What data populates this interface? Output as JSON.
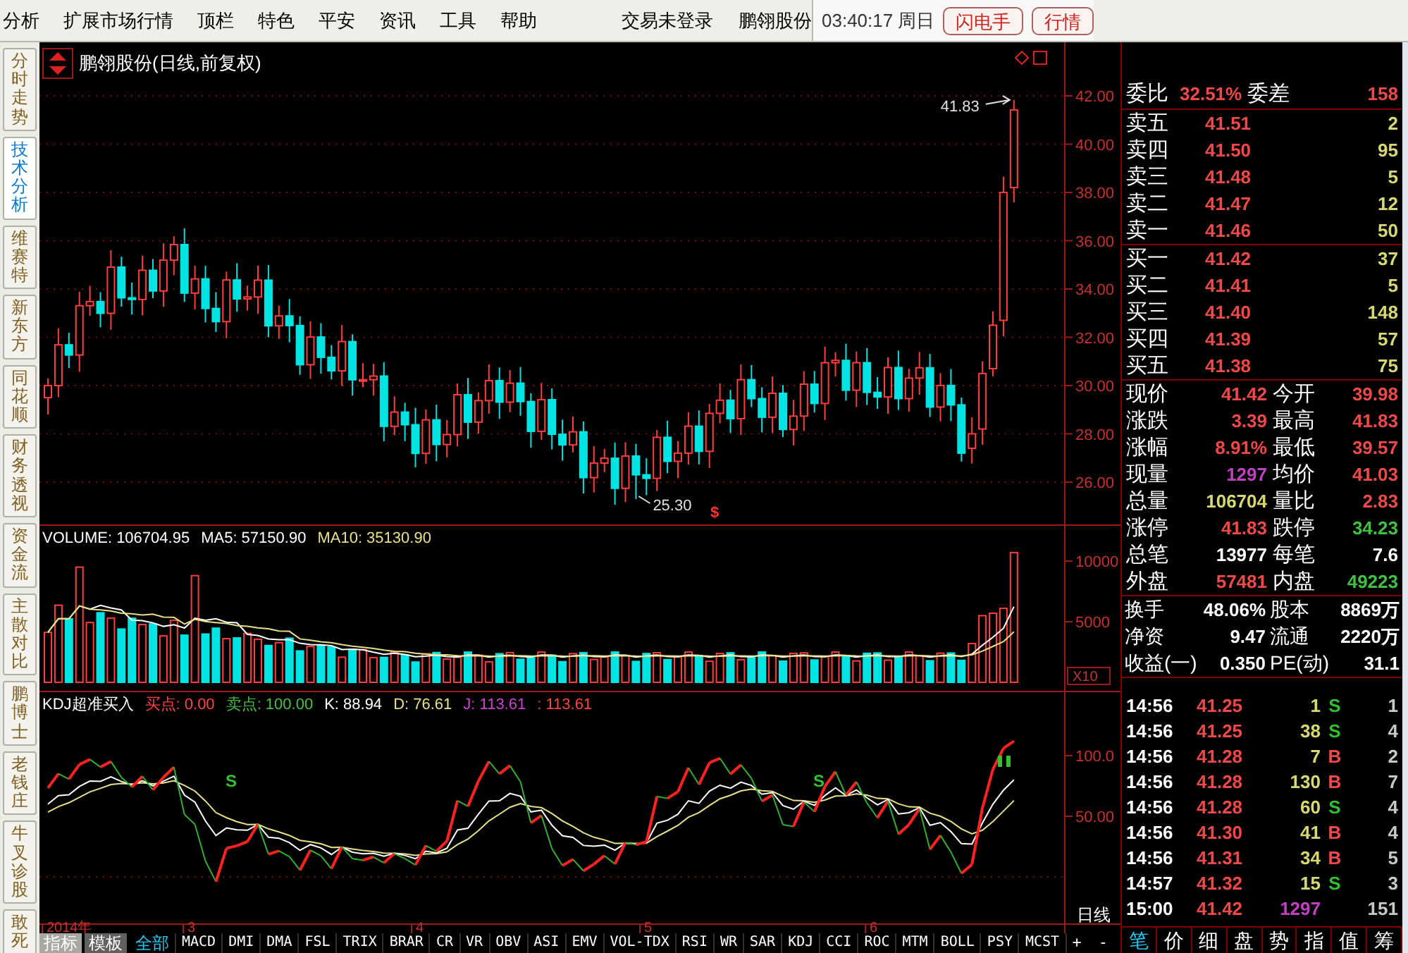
{
  "menu": [
    "分析",
    "扩展市场行情",
    "顶栏",
    "特色",
    "平安",
    "资讯",
    "工具",
    "帮助"
  ],
  "login_status": "交易未登录",
  "stock_name": "鹏翎股份",
  "clock": "03:40:17 周日",
  "header_buttons": [
    "闪电手",
    "行情"
  ],
  "side_tabs": [
    {
      "label": "分时走势",
      "selected": false
    },
    {
      "label": "技术分析",
      "selected": true
    },
    {
      "label": "维赛特",
      "selected": false
    },
    {
      "label": "新东方",
      "selected": false
    },
    {
      "label": "同花顺",
      "selected": false
    },
    {
      "label": "财务透视",
      "selected": false
    },
    {
      "label": "资金流",
      "selected": false
    },
    {
      "label": "主散对比",
      "selected": false
    },
    {
      "label": "鹏博士",
      "selected": false
    },
    {
      "label": "老钱庄",
      "selected": false
    },
    {
      "label": "牛叉诊股",
      "selected": false
    },
    {
      "label": "敢死",
      "selected": false
    }
  ],
  "price_chart": {
    "title": "鹏翎股份(日线,前复权)",
    "high_label": "41.83",
    "low_label": "25.30",
    "event_mark": "$",
    "axis_labels": [
      "42.00",
      "40.00",
      "38.00",
      "36.00",
      "34.00",
      "32.00",
      "30.00",
      "28.00",
      "26.00"
    ]
  },
  "volume_panel": {
    "legend": [
      {
        "text": "VOLUME: 106704.95",
        "color": "#ffffff"
      },
      {
        "text": "MA5: 57150.90",
        "color": "#ffffff"
      },
      {
        "text": "MA10: 35130.90",
        "color": "#e8e088"
      }
    ],
    "axis_labels": [
      "10000",
      "5000"
    ],
    "unit_label": "X10"
  },
  "kdj_panel": {
    "legend": [
      {
        "text": "KDJ超准买入",
        "color": "#ffffff"
      },
      {
        "text": "买点: 0.00",
        "color": "#ff4040"
      },
      {
        "text": "卖点: 100.00",
        "color": "#40c040"
      },
      {
        "text": "K: 88.94",
        "color": "#ffffff"
      },
      {
        "text": "D: 76.61",
        "color": "#e8e088"
      },
      {
        "text": "J: 113.61",
        "color": "#d040d0"
      },
      {
        "text": ": 113.61",
        "color": "#ff4040"
      }
    ],
    "axis_labels": [
      "100.0",
      "50.00"
    ],
    "signal_marks": [
      "S",
      "S"
    ]
  },
  "date_axis": [
    "2014年",
    "3",
    "4",
    "5",
    "6"
  ],
  "period_label": "日线",
  "indicator_tabs": [
    {
      "label": "指标",
      "kind": "mode",
      "selected": true
    },
    {
      "label": "模板",
      "kind": "mode",
      "selected": false
    },
    {
      "label": "全部",
      "kind": "tab",
      "selected": true
    },
    {
      "label": "MACD",
      "kind": "tab",
      "selected": false
    },
    {
      "label": "DMI",
      "kind": "tab",
      "selected": false
    },
    {
      "label": "DMA",
      "kind": "tab",
      "selected": false
    },
    {
      "label": "FSL",
      "kind": "tab",
      "selected": false
    },
    {
      "label": "TRIX",
      "kind": "tab",
      "selected": false
    },
    {
      "label": "BRAR",
      "kind": "tab",
      "selected": false
    },
    {
      "label": "CR",
      "kind": "tab",
      "selected": false
    },
    {
      "label": "VR",
      "kind": "tab",
      "selected": false
    },
    {
      "label": "OBV",
      "kind": "tab",
      "selected": false
    },
    {
      "label": "ASI",
      "kind": "tab",
      "selected": false
    },
    {
      "label": "EMV",
      "kind": "tab",
      "selected": false
    },
    {
      "label": "VOL-TDX",
      "kind": "tab",
      "selected": false
    },
    {
      "label": "RSI",
      "kind": "tab",
      "selected": false
    },
    {
      "label": "WR",
      "kind": "tab",
      "selected": false
    },
    {
      "label": "SAR",
      "kind": "tab",
      "selected": false
    },
    {
      "label": "KDJ",
      "kind": "tab",
      "selected": false
    },
    {
      "label": "CCI",
      "kind": "tab",
      "selected": false
    },
    {
      "label": "ROC",
      "kind": "tab",
      "selected": false
    },
    {
      "label": "MTM",
      "kind": "tab",
      "selected": false
    },
    {
      "label": "BOLL",
      "kind": "tab",
      "selected": false
    },
    {
      "label": "PSY",
      "kind": "tab",
      "selected": false
    },
    {
      "label": "MCST",
      "kind": "tab",
      "selected": false
    }
  ],
  "zoom_buttons": [
    "+",
    "-"
  ],
  "quote": {
    "ratio": [
      {
        "label": "委比",
        "value": "32.51%",
        "color": "#f04848"
      },
      {
        "label": "委差",
        "value": "158",
        "color": "#f04848"
      }
    ],
    "asks": [
      {
        "label": "卖五",
        "price": "41.51",
        "volume": "2"
      },
      {
        "label": "卖四",
        "price": "41.50",
        "volume": "95"
      },
      {
        "label": "卖三",
        "price": "41.48",
        "volume": "5"
      },
      {
        "label": "卖二",
        "price": "41.47",
        "volume": "12"
      },
      {
        "label": "卖一",
        "price": "41.46",
        "volume": "50"
      }
    ],
    "bids": [
      {
        "label": "买一",
        "price": "41.42",
        "volume": "37"
      },
      {
        "label": "买二",
        "price": "41.41",
        "volume": "5"
      },
      {
        "label": "买三",
        "price": "41.40",
        "volume": "148"
      },
      {
        "label": "买四",
        "price": "41.39",
        "volume": "57"
      },
      {
        "label": "买五",
        "price": "41.38",
        "volume": "75"
      }
    ],
    "stats": [
      [
        {
          "label": "现价",
          "value": "41.42",
          "color": "#f04848"
        },
        {
          "label": "今开",
          "value": "39.98",
          "color": "#f04848"
        }
      ],
      [
        {
          "label": "涨跌",
          "value": "3.39",
          "color": "#f04848"
        },
        {
          "label": "最高",
          "value": "41.83",
          "color": "#f04848"
        }
      ],
      [
        {
          "label": "涨幅",
          "value": "8.91%",
          "color": "#f04848"
        },
        {
          "label": "最低",
          "value": "39.57",
          "color": "#f04848"
        }
      ],
      [
        {
          "label": "现量",
          "value": "1297",
          "color": "#c040c0"
        },
        {
          "label": "均价",
          "value": "41.03",
          "color": "#f04848"
        }
      ],
      [
        {
          "label": "总量",
          "value": "106704",
          "color": "#d8d870"
        },
        {
          "label": "量比",
          "value": "2.83",
          "color": "#f04848"
        }
      ],
      [
        {
          "label": "涨停",
          "value": "41.83",
          "color": "#f04848"
        },
        {
          "label": "跌停",
          "value": "34.23",
          "color": "#40c040"
        }
      ],
      [
        {
          "label": "总笔",
          "value": "13977",
          "color": "#ffffff"
        },
        {
          "label": "每笔",
          "value": "7.6",
          "color": "#ffffff"
        }
      ],
      [
        {
          "label": "外盘",
          "value": "57481",
          "color": "#f04848"
        },
        {
          "label": "内盘",
          "value": "49223",
          "color": "#40c040"
        }
      ]
    ],
    "fundamentals": [
      [
        {
          "label": "换手",
          "value": "48.06%"
        },
        {
          "label": "股本",
          "value": "8869万"
        }
      ],
      [
        {
          "label": "净资",
          "value": "9.47"
        },
        {
          "label": "流通",
          "value": "2220万"
        }
      ],
      [
        {
          "label": "收益(一)",
          "value": "0.350"
        },
        {
          "label": "PE(动)",
          "value": "31.1"
        }
      ]
    ],
    "ticks": [
      {
        "time": "14:56",
        "price": "41.25",
        "volume": "1",
        "side": "S",
        "kind": "sell",
        "count": "1"
      },
      {
        "time": "14:56",
        "price": "41.25",
        "volume": "38",
        "side": "S",
        "kind": "sell",
        "count": "4"
      },
      {
        "time": "14:56",
        "price": "41.28",
        "volume": "7",
        "side": "B",
        "kind": "buy",
        "count": "2"
      },
      {
        "time": "14:56",
        "price": "41.28",
        "volume": "130",
        "side": "B",
        "kind": "buy",
        "count": "7"
      },
      {
        "time": "14:56",
        "price": "41.28",
        "volume": "60",
        "side": "S",
        "kind": "sell",
        "count": "4"
      },
      {
        "time": "14:56",
        "price": "41.30",
        "volume": "41",
        "side": "B",
        "kind": "buy",
        "count": "4"
      },
      {
        "time": "14:56",
        "price": "41.31",
        "volume": "34",
        "side": "B",
        "kind": "buy",
        "count": "5"
      },
      {
        "time": "14:57",
        "price": "41.32",
        "volume": "15",
        "side": "S",
        "kind": "sell",
        "count": "3"
      },
      {
        "time": "15:00",
        "price": "41.42",
        "volume": "1297",
        "kind": "close",
        "count": "151"
      }
    ],
    "tabs": [
      {
        "label": "笔",
        "selected": true
      },
      {
        "label": "价",
        "selected": false
      },
      {
        "label": "细",
        "selected": false
      },
      {
        "label": "盘",
        "selected": false
      },
      {
        "label": "势",
        "selected": false
      },
      {
        "label": "指",
        "selected": false
      },
      {
        "label": "值",
        "selected": false
      },
      {
        "label": "筹",
        "selected": false
      }
    ]
  }
}
